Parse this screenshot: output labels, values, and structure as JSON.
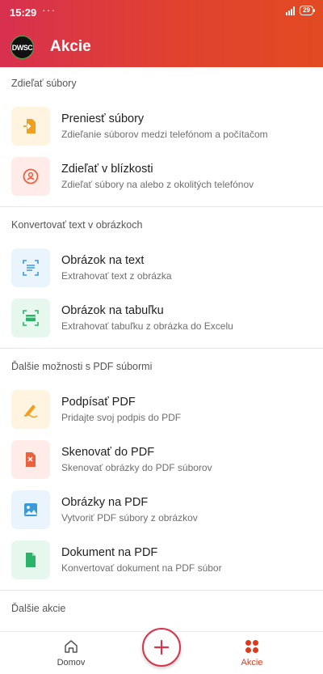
{
  "status_bar": {
    "time": "15:29",
    "dots": "···",
    "battery": "29"
  },
  "header": {
    "avatar_text": "DWSC",
    "title": "Akcie"
  },
  "sections": [
    {
      "title": "Zdieľať súbory",
      "items": [
        {
          "title": "Preniesť súbory",
          "subtitle": "Zdieľanie súborov medzi telefónom a počítačom"
        },
        {
          "title": "Zdieľať v blízkosti",
          "subtitle": "Zdieľať súbory na alebo z okolitých telefónov"
        }
      ]
    },
    {
      "title": "Konvertovať text v obrázkoch",
      "items": [
        {
          "title": "Obrázok na text",
          "subtitle": "Extrahovať text z obrázka"
        },
        {
          "title": "Obrázok na tabuľku",
          "subtitle": "Extrahovať tabuľku z obrázka do Excelu"
        }
      ]
    },
    {
      "title": "Ďalšie možnosti s PDF súbormi",
      "items": [
        {
          "title": "Podpísať PDF",
          "subtitle": "Pridajte svoj podpis do PDF"
        },
        {
          "title": "Skenovať do PDF",
          "subtitle": "Skenovať obrázky do PDF súborov"
        },
        {
          "title": "Obrázky na PDF",
          "subtitle": "Vytvoriť PDF súbory z obrázkov"
        },
        {
          "title": "Dokument na PDF",
          "subtitle": "Konvertovať dokument na PDF súbor"
        }
      ]
    },
    {
      "title": "Ďalšie akcie"
    }
  ],
  "bottom_nav": {
    "home_label": "Domov",
    "actions_label": "Akcie"
  },
  "colors": {
    "accent": "#dd3a1d",
    "header_start": "#d8304f",
    "header_end": "#e24a22"
  }
}
